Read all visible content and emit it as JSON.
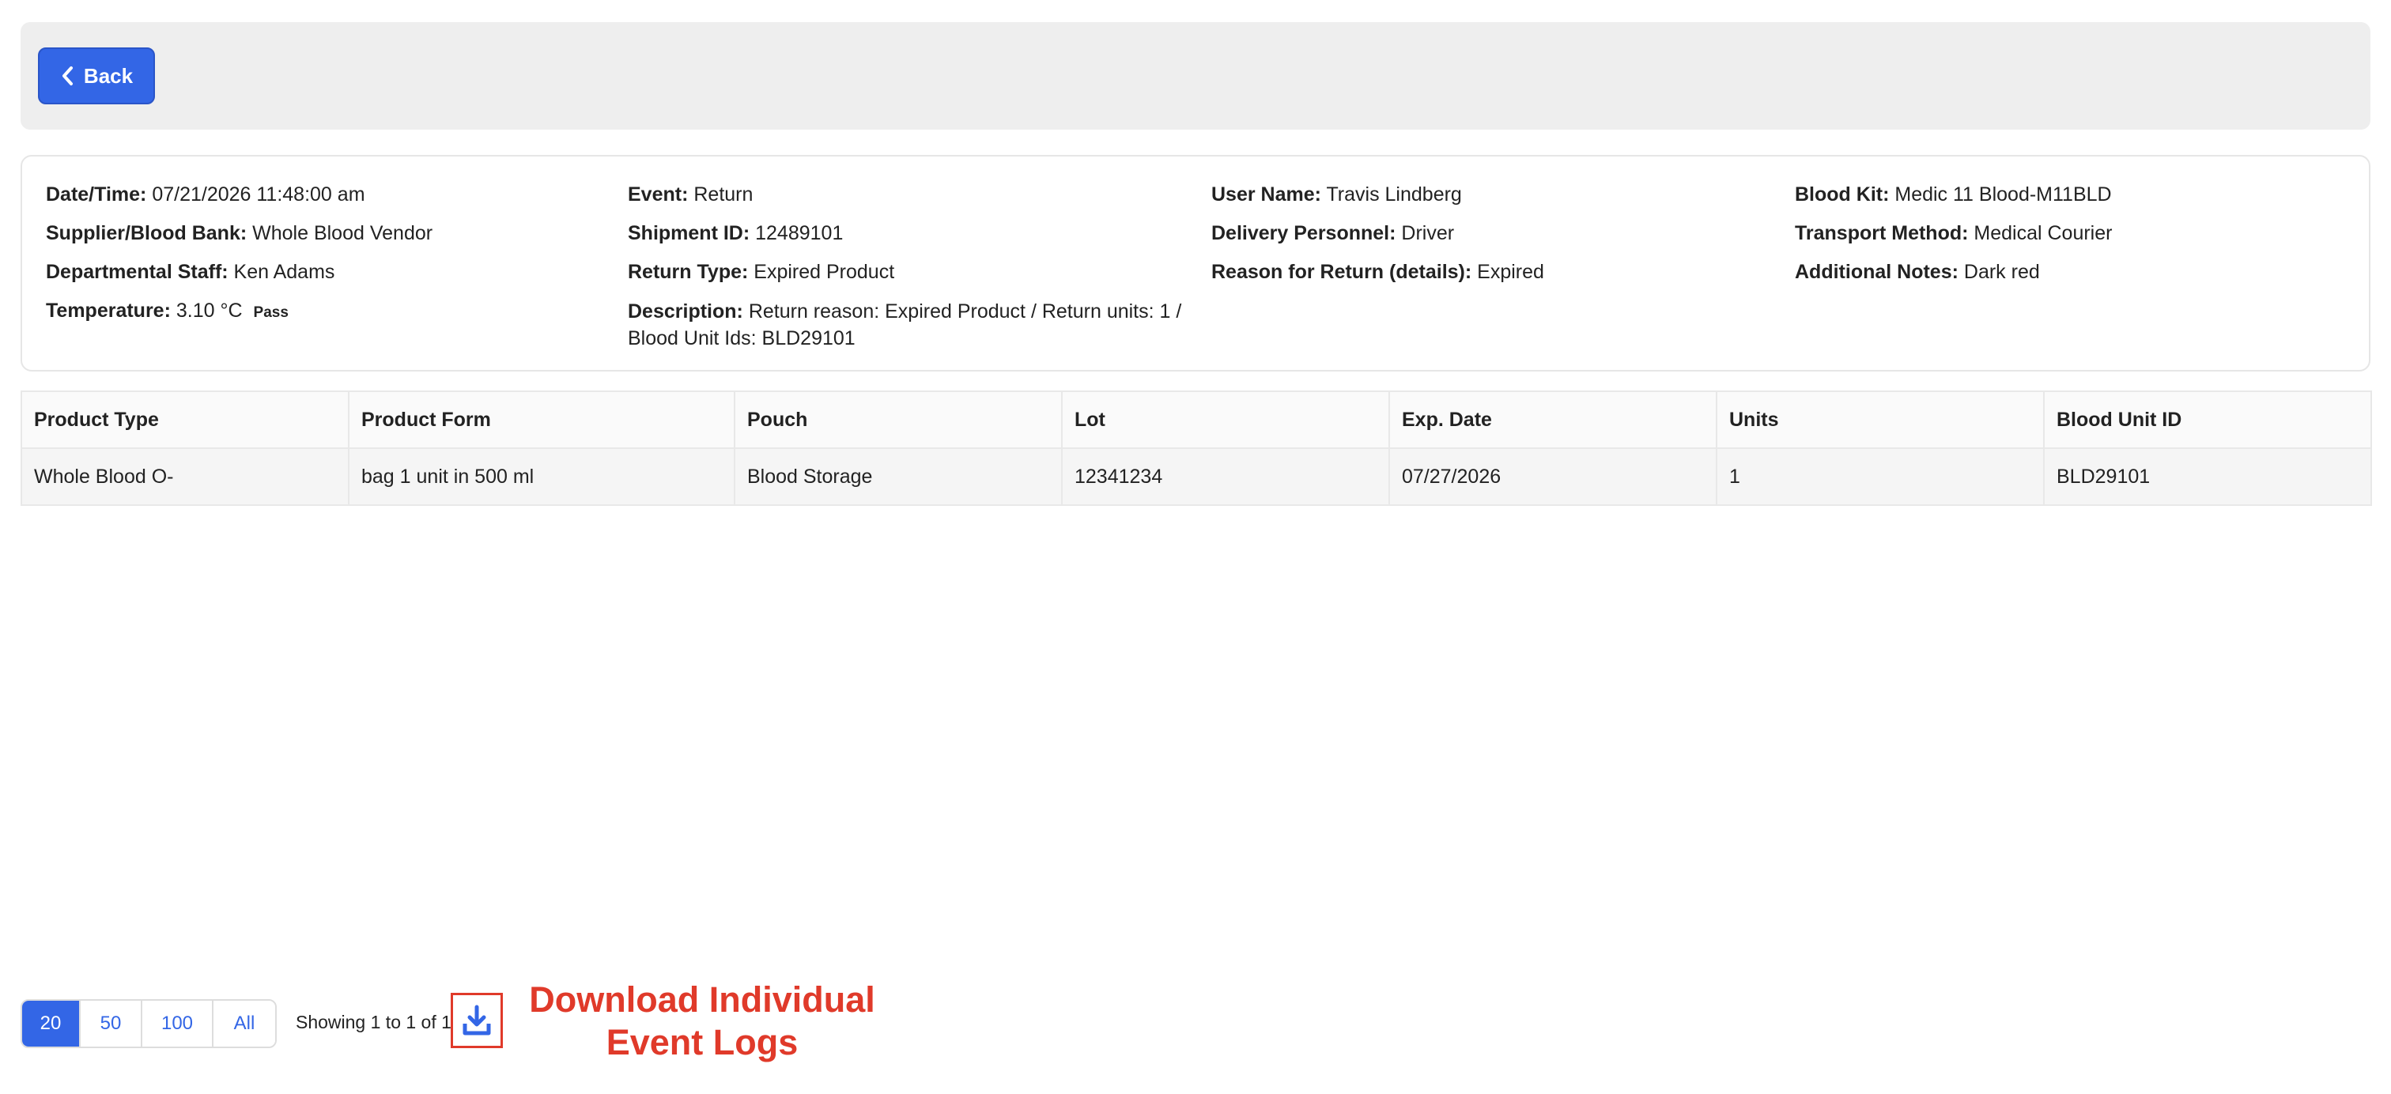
{
  "header": {
    "back_label": "Back"
  },
  "details": {
    "col1": [
      {
        "label": "Date/Time:",
        "value": "07/21/2026 11:48:00 am"
      },
      {
        "label": "Supplier/Blood Bank:",
        "value": "Whole Blood Vendor"
      },
      {
        "label": "Departmental Staff:",
        "value": "Ken Adams"
      },
      {
        "label": "Temperature:",
        "value": "3.10 °C",
        "badge": "Pass"
      }
    ],
    "col2": [
      {
        "label": "Event:",
        "value": "Return"
      },
      {
        "label": "Shipment ID:",
        "value": "12489101"
      },
      {
        "label": "Return Type:",
        "value": "Expired Product"
      },
      {
        "label": "Description:",
        "value": "Return reason: Expired Product / Return units: 1 / Blood Unit Ids: BLD29101"
      }
    ],
    "col3": [
      {
        "label": "User Name:",
        "value": "Travis Lindberg"
      },
      {
        "label": "Delivery Personnel:",
        "value": "Driver"
      },
      {
        "label": "Reason for Return (details):",
        "value": "Expired"
      }
    ],
    "col4": [
      {
        "label": "Blood Kit:",
        "value": "Medic 11 Blood-M11BLD"
      },
      {
        "label": "Transport Method:",
        "value": "Medical Courier"
      },
      {
        "label": "Additional Notes:",
        "value": "Dark red"
      }
    ]
  },
  "table": {
    "headers": [
      "Product Type",
      "Product Form",
      "Pouch",
      "Lot",
      "Exp. Date",
      "Units",
      "Blood Unit ID"
    ],
    "rows": [
      [
        "Whole Blood O-",
        "bag 1 unit in 500 ml",
        "Blood Storage",
        "12341234",
        "07/27/2026",
        "1",
        "BLD29101"
      ]
    ]
  },
  "pagination": {
    "options": [
      "20",
      "50",
      "100",
      "All"
    ],
    "selected": "20",
    "showing_text": "Showing 1 to 1 of 1"
  },
  "download": {
    "icon": "download-icon"
  },
  "annotation": {
    "text": "Download Individual Event Logs"
  },
  "colors": {
    "primary": "#3366e6",
    "annotation": "#e03a2a",
    "topbar_bg": "#eeeeee"
  }
}
